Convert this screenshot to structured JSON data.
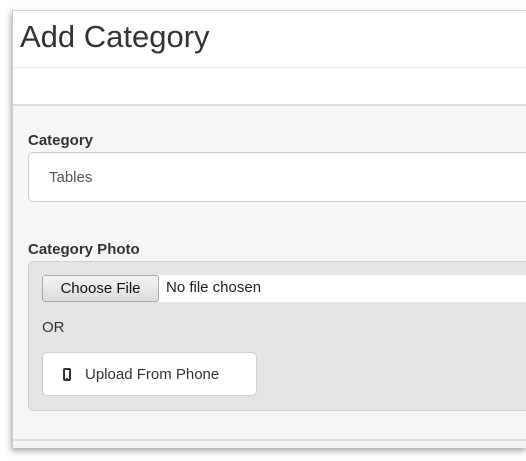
{
  "header": {
    "title": "Add Category"
  },
  "form": {
    "category": {
      "label": "Category",
      "value": "Tables"
    },
    "photo": {
      "label": "Category Photo",
      "choose_file_label": "Choose File",
      "file_status": "No file chosen",
      "or_text": "OR",
      "upload_phone_label": "Upload From Phone",
      "upload_icon": "mobile-phone-icon"
    }
  }
}
